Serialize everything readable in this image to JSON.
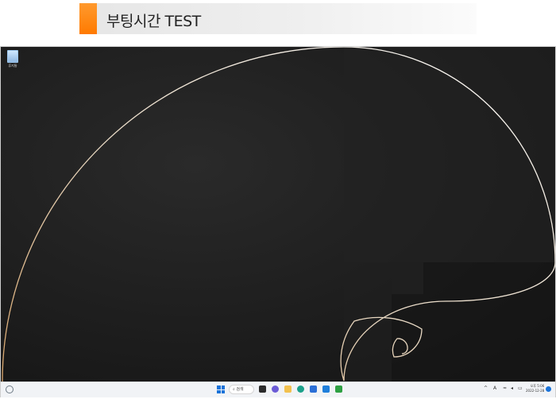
{
  "banner": {
    "title": "부팅시간 TEST"
  },
  "desktop": {
    "recycle_bin_label": "휴지통"
  },
  "taskbar": {
    "search_label": "검색",
    "tray_language": "A",
    "clock_time": "오후 5:06",
    "clock_date": "2022-12-28"
  }
}
